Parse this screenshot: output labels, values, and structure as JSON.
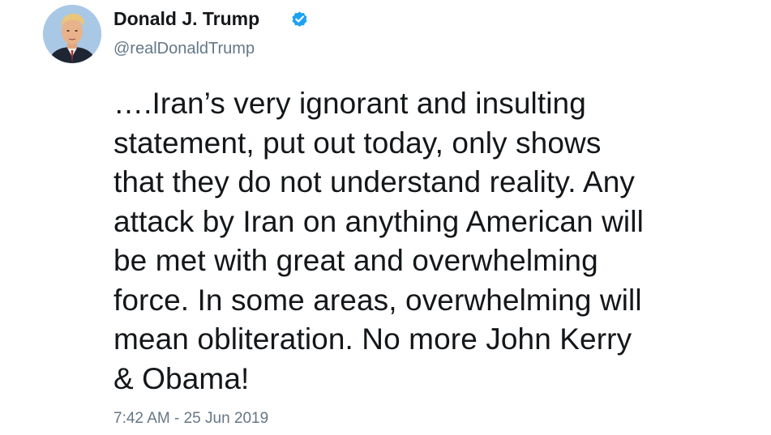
{
  "tweet": {
    "author": {
      "name": "Donald J. Trump",
      "handle": "@realDonaldTrump",
      "verified_icon": "verified-badge-icon",
      "verified_color": "#1da1f2"
    },
    "text": "….Iran’s very ignorant and insulting\nstatement, put out today, only shows\nthat they do not understand reality. Any\nattack by Iran on anything American will\nbe met with great and overwhelming\nforce. In some areas, overwhelming will\nmean obliteration. No more John Kerry\n& Obama!",
    "timestamp": "7:42 AM - 25 Jun 2019"
  }
}
